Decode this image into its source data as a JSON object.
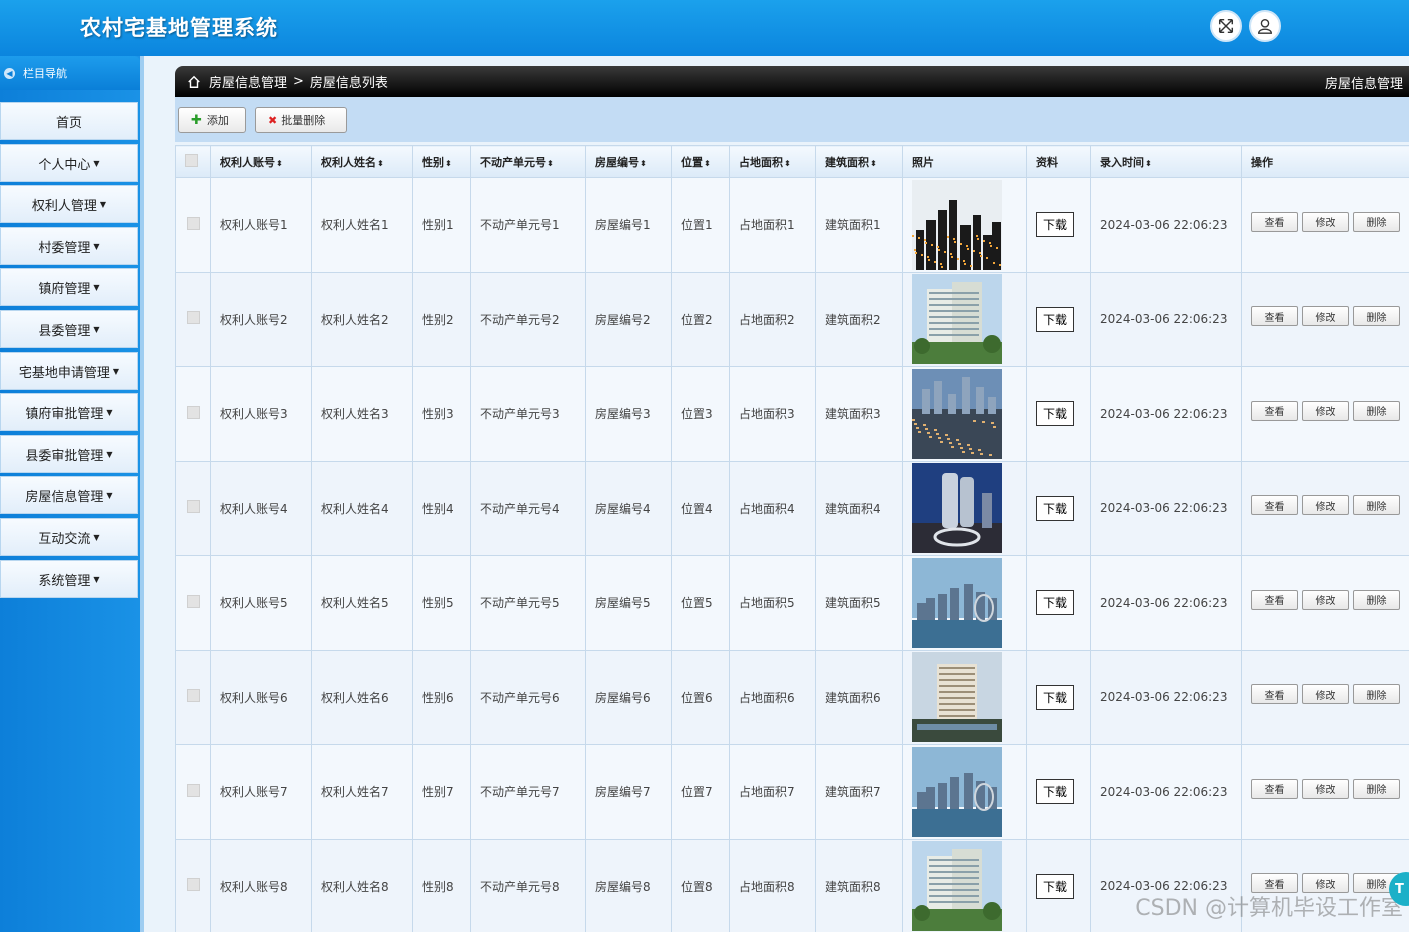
{
  "header": {
    "title": "农村宅基地管理系统"
  },
  "sidebar": {
    "heading": "栏目导航",
    "items": [
      {
        "label": "首页",
        "caret": ""
      },
      {
        "label": "个人中心",
        "caret": "▼"
      },
      {
        "label": "权利人管理",
        "caret": "▼"
      },
      {
        "label": "村委管理",
        "caret": "▼"
      },
      {
        "label": "镇府管理",
        "caret": "▼"
      },
      {
        "label": "县委管理",
        "caret": "▼"
      },
      {
        "label": "宅基地申请管理",
        "caret": "▼"
      },
      {
        "label": "镇府审批管理",
        "caret": "▼"
      },
      {
        "label": "县委审批管理",
        "caret": "▼"
      },
      {
        "label": "房屋信息管理",
        "caret": "▼"
      },
      {
        "label": "互动交流",
        "caret": "▼"
      },
      {
        "label": "系统管理",
        "caret": "▼"
      }
    ]
  },
  "breadcrumb": {
    "home": "房屋信息管理",
    "sep": ">",
    "current": "房屋信息列表",
    "right": "房屋信息管理"
  },
  "toolbar": {
    "add": "添加",
    "batch_delete": "批量删除"
  },
  "table": {
    "sort_glyph": "⬍",
    "headers": [
      "权利人账号",
      "权利人姓名",
      "性别",
      "不动产单元号",
      "房屋编号",
      "位置",
      "占地面积",
      "建筑面积",
      "照片",
      "资料",
      "录入时间",
      "操作"
    ],
    "download": "下载",
    "actions": {
      "view": "查看",
      "edit": "修改",
      "delete": "删除"
    },
    "rows": [
      {
        "account": "权利人账号1",
        "name": "权利人姓名1",
        "gender": "性别1",
        "unit": "不动产单元号1",
        "house": "房屋编号1",
        "location": "位置1",
        "land": "占地面积1",
        "building": "建筑面积1",
        "time": "2024-03-06 22:06:23",
        "photo": "night-city"
      },
      {
        "account": "权利人账号2",
        "name": "权利人姓名2",
        "gender": "性别2",
        "unit": "不动产单元号2",
        "house": "房屋编号2",
        "location": "位置2",
        "land": "占地面积2",
        "building": "建筑面积2",
        "time": "2024-03-06 22:06:23",
        "photo": "apartment"
      },
      {
        "account": "权利人账号3",
        "name": "权利人姓名3",
        "gender": "性别3",
        "unit": "不动产单元号3",
        "house": "房屋编号3",
        "location": "位置3",
        "land": "占地面积3",
        "building": "建筑面积3",
        "time": "2024-03-06 22:06:23",
        "photo": "aerial-city"
      },
      {
        "account": "权利人账号4",
        "name": "权利人姓名4",
        "gender": "性别4",
        "unit": "不动产单元号4",
        "house": "房屋编号4",
        "location": "位置4",
        "land": "占地面积4",
        "building": "建筑面积4",
        "time": "2024-03-06 22:06:23",
        "photo": "tower-dusk"
      },
      {
        "account": "权利人账号5",
        "name": "权利人姓名5",
        "gender": "性别5",
        "unit": "不动产单元号5",
        "house": "房屋编号5",
        "location": "位置5",
        "land": "占地面积5",
        "building": "建筑面积5",
        "time": "2024-03-06 22:06:23",
        "photo": "sea-skyline"
      },
      {
        "account": "权利人账号6",
        "name": "权利人姓名6",
        "gender": "性别6",
        "unit": "不动产单元号6",
        "house": "房屋编号6",
        "location": "位置6",
        "land": "占地面积6",
        "building": "建筑面积6",
        "time": "2024-03-06 22:06:23",
        "photo": "hotel-building"
      },
      {
        "account": "权利人账号7",
        "name": "权利人姓名7",
        "gender": "性别7",
        "unit": "不动产单元号7",
        "house": "房屋编号7",
        "location": "位置7",
        "land": "占地面积7",
        "building": "建筑面积7",
        "time": "2024-03-06 22:06:23",
        "photo": "sea-skyline"
      },
      {
        "account": "权利人账号8",
        "name": "权利人姓名8",
        "gender": "性别8",
        "unit": "不动产单元号8",
        "house": "房屋编号8",
        "location": "位置8",
        "land": "占地面积8",
        "building": "建筑面积8",
        "time": "2024-03-06 22:06:23",
        "photo": "apartment"
      }
    ]
  },
  "watermark": "CSDN @计算机毕设工作室",
  "float_ball": "T"
}
